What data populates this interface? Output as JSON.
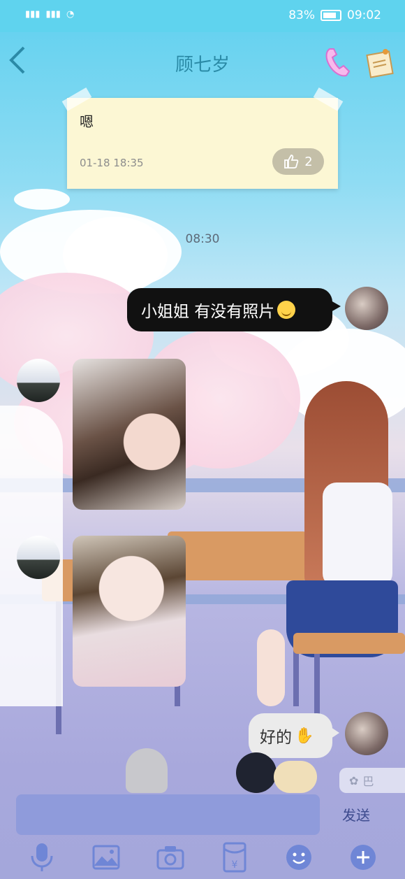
{
  "status_bar": {
    "network_left": "HD 4G 2G",
    "battery": "83%",
    "time": "09:02"
  },
  "header": {
    "title": "顾七岁"
  },
  "pinned_note": {
    "text": "嗯",
    "time": "01-18 18:35",
    "likes": "2"
  },
  "chat": {
    "timestamp": "08:30",
    "messages": [
      {
        "from": "me",
        "type": "text",
        "text": "小姐姐 有没有照片"
      },
      {
        "from": "other",
        "type": "image"
      },
      {
        "from": "other",
        "type": "image"
      },
      {
        "from": "me",
        "type": "text",
        "text": "好的"
      }
    ]
  },
  "input": {
    "value": "",
    "send_label": "发送",
    "hint": "巴"
  },
  "toolbar": {
    "icons": [
      "microphone-icon",
      "image-icon",
      "camera-icon",
      "red-packet-icon",
      "emoji-icon",
      "plus-icon"
    ]
  },
  "colors": {
    "status_bar": "#5fd3ee",
    "title": "#2a8aa6",
    "input_box": "#8f9bdb",
    "toolbar_icon": "#6f86d6"
  }
}
